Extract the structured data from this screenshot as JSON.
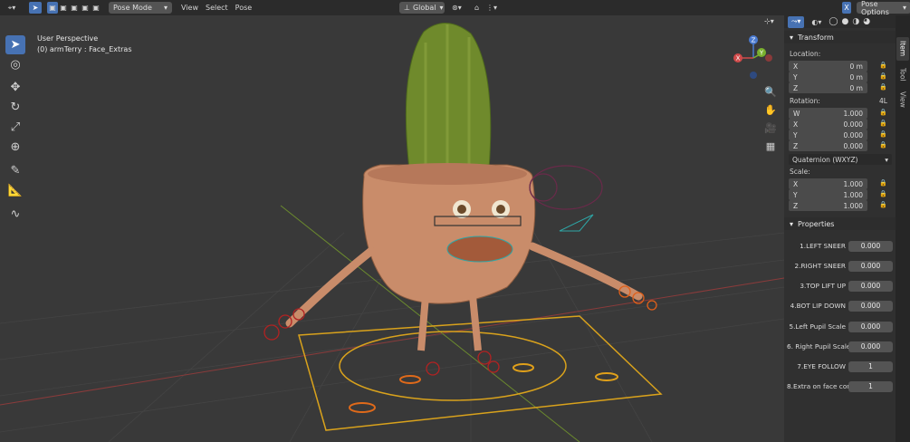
{
  "header": {
    "mode_label": "Pose Mode",
    "menus": [
      "View",
      "Select",
      "Pose"
    ],
    "orientation": "Global",
    "pose_options": "Pose Options",
    "x_toggle": "X"
  },
  "viewport": {
    "perspective": "User Perspective",
    "context": "(0) armTerry : Face_Extras"
  },
  "gizmo": {
    "x": "X",
    "y": "Y",
    "z": "Z"
  },
  "transform": {
    "title": "Transform",
    "location_label": "Location:",
    "location": [
      {
        "axis": "X",
        "value": "0 m"
      },
      {
        "axis": "Y",
        "value": "0 m"
      },
      {
        "axis": "Z",
        "value": "0 m"
      }
    ],
    "rotation_label": "Rotation:",
    "rotation_mode_short": "4L",
    "rotation": [
      {
        "axis": "W",
        "value": "1.000"
      },
      {
        "axis": "X",
        "value": "0.000"
      },
      {
        "axis": "Y",
        "value": "0.000"
      },
      {
        "axis": "Z",
        "value": "0.000"
      }
    ],
    "rotation_mode": "Quaternion (WXYZ)",
    "scale_label": "Scale:",
    "scale": [
      {
        "axis": "X",
        "value": "1.000"
      },
      {
        "axis": "Y",
        "value": "1.000"
      },
      {
        "axis": "Z",
        "value": "1.000"
      }
    ]
  },
  "properties": {
    "title": "Properties",
    "items": [
      {
        "label": "1.LEFT SNEER",
        "value": "0.000"
      },
      {
        "label": "2.RIGHT SNEER",
        "value": "0.000"
      },
      {
        "label": "3.TOP LIFT UP",
        "value": "0.000"
      },
      {
        "label": "4.BOT LIP DOWN",
        "value": "0.000"
      },
      {
        "label": "5.Left Pupil Scale",
        "value": "0.000"
      },
      {
        "label": "6. Right Pupil Scale",
        "value": "0.000"
      },
      {
        "label": "7.EYE FOLLOW",
        "value": "1"
      },
      {
        "label": "8.Extra on face con...",
        "value": "1"
      }
    ]
  },
  "sidebar_tabs": [
    "Item",
    "Tool",
    "View"
  ]
}
